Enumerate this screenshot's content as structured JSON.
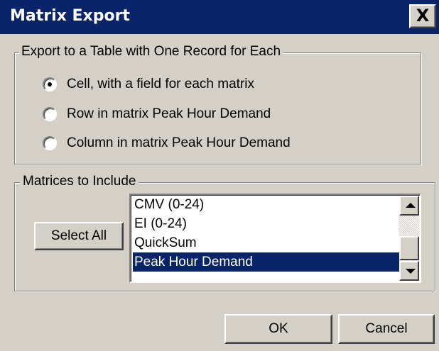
{
  "window": {
    "title": "Matrix Export",
    "close_glyph": "X"
  },
  "export_group": {
    "legend": "Export to a Table with One Record for Each",
    "options": [
      {
        "label": "Cell, with a field for each matrix",
        "checked": true
      },
      {
        "label": "Row in matrix Peak Hour Demand",
        "checked": false
      },
      {
        "label": "Column in matrix Peak Hour Demand",
        "checked": false
      }
    ]
  },
  "matrices_group": {
    "legend": "Matrices to Include",
    "select_all_label": "Select All",
    "items": [
      {
        "label": "CMV (0-24)",
        "selected": false
      },
      {
        "label": "EI (0-24)",
        "selected": false
      },
      {
        "label": "QuickSum",
        "selected": false
      },
      {
        "label": "Peak Hour Demand",
        "selected": true
      }
    ]
  },
  "buttons": {
    "ok_label": "OK",
    "cancel_label": "Cancel"
  },
  "colors": {
    "title_bar": "#0a246a",
    "face": "#d4d0c8",
    "selection": "#0a246a"
  }
}
